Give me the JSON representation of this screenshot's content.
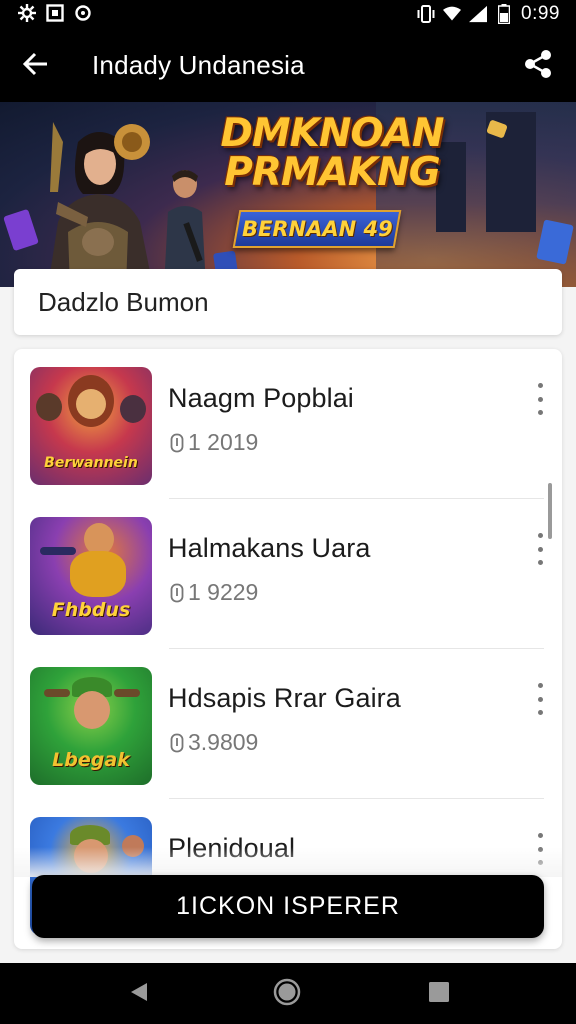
{
  "status_bar": {
    "time": "0:99",
    "left_icons": [
      "settings-icon",
      "photo-icon",
      "sync-icon"
    ],
    "right_icons": [
      "vibrate-icon",
      "wifi-icon",
      "signal-icon",
      "battery-icon"
    ]
  },
  "app_bar": {
    "title": "Indady Undanesia",
    "back_icon": "arrow-left-icon",
    "share_icon": "share-icon"
  },
  "banner": {
    "title_line1": "DMKNOAN",
    "title_line2": "PRMAKNG",
    "ribbon": "BERNAAN 49"
  },
  "search": {
    "text": "Dadzlo Bumon"
  },
  "list": {
    "items": [
      {
        "title": "Naagm Popblai",
        "meta": "1 2019",
        "meta_icon": "download-icon",
        "thumb_label": "Berwannein",
        "thumb_colors": [
          "#6a2e6e",
          "#c6384d",
          "#f0a040"
        ]
      },
      {
        "title": "Halmakans Uara",
        "meta": "1 9229",
        "meta_icon": "download-icon",
        "thumb_label": "Fhbdus",
        "thumb_colors": [
          "#3b2a78",
          "#8a3fb0",
          "#e27a3a"
        ]
      },
      {
        "title": "Hdsapis Rrar Gaira",
        "meta": "3.9809",
        "meta_icon": "download-icon",
        "thumb_label": "Lbegak",
        "thumb_colors": [
          "#1e6e2a",
          "#2fa23a",
          "#f2c230"
        ]
      },
      {
        "title": "Plenidoual",
        "meta": "",
        "meta_icon": "",
        "thumb_label": "",
        "thumb_colors": [
          "#1f4fb0",
          "#3b7ae0",
          "#f0b030"
        ]
      }
    ],
    "more_icon": "more-vertical-icon"
  },
  "primary_button": {
    "label": "1ICKON ISPERER"
  },
  "nav_bar": {
    "icons": [
      "back-triangle-icon",
      "home-circle-icon",
      "recents-square-icon"
    ]
  },
  "colors": {
    "bar_background": "#000000",
    "content_background": "#f4f4f4",
    "card_background": "#ffffff",
    "banner_accent": "#ffc533",
    "ribbon_blue": "#2a4fc0"
  }
}
